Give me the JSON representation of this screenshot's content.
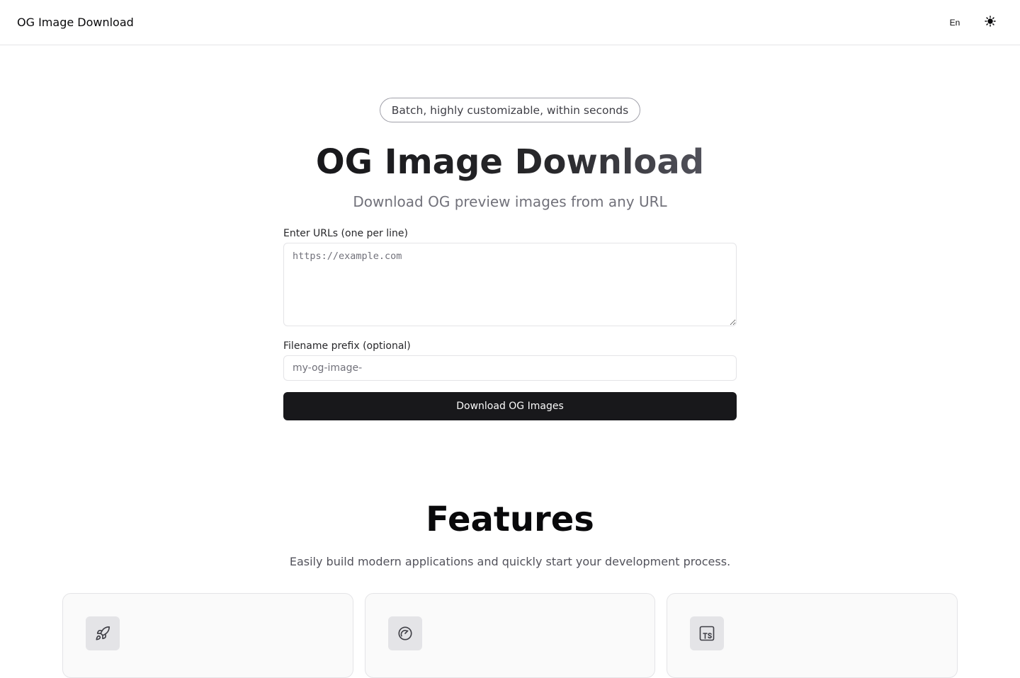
{
  "header": {
    "brand": "OG Image Download",
    "language_label": "En",
    "theme_toggle_icon": "sun-icon"
  },
  "hero": {
    "badge": "Batch, highly customizable, within seconds",
    "title": "OG Image Download",
    "subtitle": "Download OG preview images from any URL"
  },
  "form": {
    "urls_label": "Enter URLs (one per line)",
    "urls_placeholder": "https://example.com",
    "urls_value": "",
    "prefix_label": "Filename prefix (optional)",
    "prefix_placeholder": "my-og-image-",
    "prefix_value": "",
    "submit_label": "Download OG Images"
  },
  "features": {
    "title": "Features",
    "subtitle": "Easily build modern applications and quickly start your development process.",
    "cards": [
      {
        "icon": "rocket-icon"
      },
      {
        "icon": "gauge-icon"
      },
      {
        "icon": "typescript-icon"
      }
    ]
  },
  "colors": {
    "primary_button": "#18181b",
    "border": "#e4e4e7",
    "muted_text": "#71717a"
  }
}
